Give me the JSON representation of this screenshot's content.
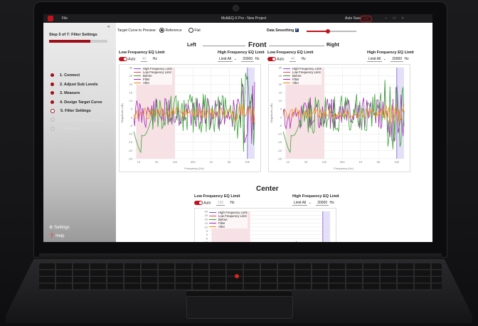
{
  "window": {
    "menu_file": "File",
    "title": "MultiEQ-X Pro - New Project",
    "auto_save_label": "Auto Save",
    "auto_save_state": "OFF"
  },
  "sidebar": {
    "step_title": "Step 5 of 7: Filter Settings",
    "progress": 0.71,
    "steps": [
      {
        "label": "1. Connect",
        "state": "done"
      },
      {
        "label": "2. Adjust Sub Levels",
        "state": "done"
      },
      {
        "label": "3. Measure",
        "state": "done"
      },
      {
        "label": "4. Design Target Curve",
        "state": "done"
      },
      {
        "label": "5. Filter Settings",
        "state": "current"
      },
      {
        "label": "6. Calibration Settings",
        "state": "disabled"
      },
      {
        "label": "7. Finalize",
        "state": "disabled"
      }
    ],
    "settings_label": "Settings",
    "help_label": "Help"
  },
  "toolbar": {
    "preview_label": "Target Curve to Preview:",
    "reference_label": "Reference",
    "flat_label": "Flat",
    "smoothing_label": "Data Smoothing"
  },
  "front": {
    "group_title": "Front",
    "left_label": "Left",
    "right_label": "Right",
    "lf_label": "Low Frequency EQ Limit",
    "hf_label": "High Frequency EQ Limit",
    "auto_label": "Auto",
    "lf_value": "40",
    "hz": "Hz",
    "limit_all": "Limit All",
    "hf_value": "20000"
  },
  "center": {
    "group_title": "Center",
    "lf_label": "Low Frequency EQ Limit",
    "hf_label": "High Frequency EQ Limit",
    "auto_label": "Auto",
    "lf_value": "130",
    "hz": "Hz",
    "limit_all": "Limit All",
    "hf_value": "20000"
  },
  "legend": [
    "High Frequency Limit",
    "Low Frequency Limit",
    "Before",
    "Filter",
    "After"
  ],
  "colors": {
    "accent": "#c0141d",
    "before": "#3aa335",
    "filter": "#a52bb8",
    "after": "#f08c1a",
    "hf_limit": "#7a5ad8",
    "lf_limit": "#e0506a"
  },
  "chart_axes": {
    "x_ticks": [
      "10",
      "50",
      "100",
      "500",
      "1K",
      "5K",
      "10K"
    ],
    "y_ticks": [
      "30",
      "25",
      "20",
      "15",
      "10",
      "5",
      "0",
      "-5",
      "-10",
      "-15",
      "-20",
      "-25"
    ],
    "xlabel": "Frequency (Hz)",
    "ylabel": "Magnitude (dB)"
  }
}
